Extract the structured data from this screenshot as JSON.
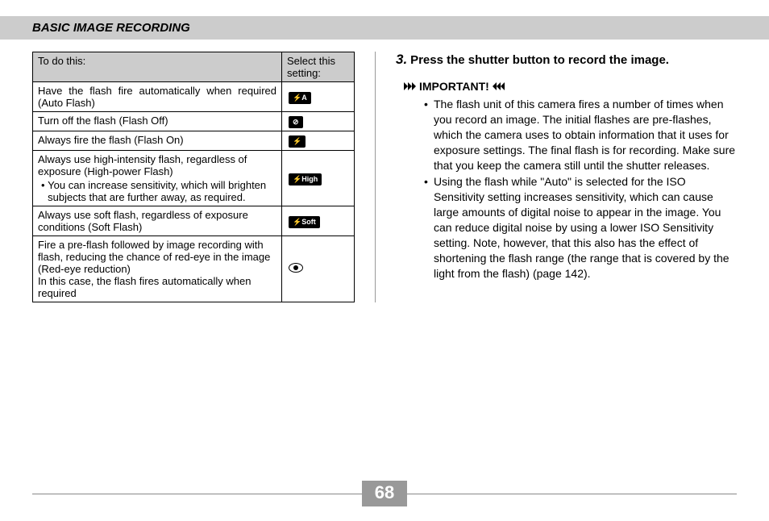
{
  "header": "BASIC IMAGE RECORDING",
  "table": {
    "col1": "To do this:",
    "col2": "Select this setting:",
    "rows": [
      {
        "desc": "Have the flash fire automatically when required (Auto Flash)",
        "sub": "",
        "icon": "⚡A"
      },
      {
        "desc": "Turn off the flash (Flash Off)",
        "sub": "",
        "icon": "⊘"
      },
      {
        "desc": "Always fire the flash (Flash On)",
        "sub": "",
        "icon": "⚡"
      },
      {
        "desc": "Always use high-intensity flash, regardless of exposure (High-power Flash)",
        "sub": "You can increase sensitivity, which will brighten subjects that are further away, as required.",
        "icon": "⚡High"
      },
      {
        "desc": "Always use soft flash, regardless of exposure conditions (Soft Flash)",
        "sub": "",
        "icon": "⚡Soft"
      },
      {
        "desc": "Fire a pre-flash followed by image recording with flash, reducing the chance of red-eye in the image (Red-eye reduction)",
        "desc2": "In this case, the flash fires automatically when required",
        "sub": "",
        "icon": "eye"
      }
    ]
  },
  "step": {
    "num": "3.",
    "text": "Press the shutter button to record the image."
  },
  "important": "IMPORTANT!",
  "bullets": [
    "The flash unit of this camera fires a number of times when you record an image. The initial flashes are pre-flashes, which the camera uses to obtain information that it uses for exposure settings. The final flash is for recording. Make sure that you keep the camera still until the shutter releases.",
    "Using the flash while \"Auto\" is selected for the ISO Sensitivity setting increases sensitivity, which can cause large amounts of digital noise to appear in the image. You can reduce digital noise by using a lower ISO Sensitivity setting. Note, however, that this also has the effect of shortening the flash range (the range that is covered by the light from the flash) (page 142)."
  ],
  "pageNumber": "68"
}
